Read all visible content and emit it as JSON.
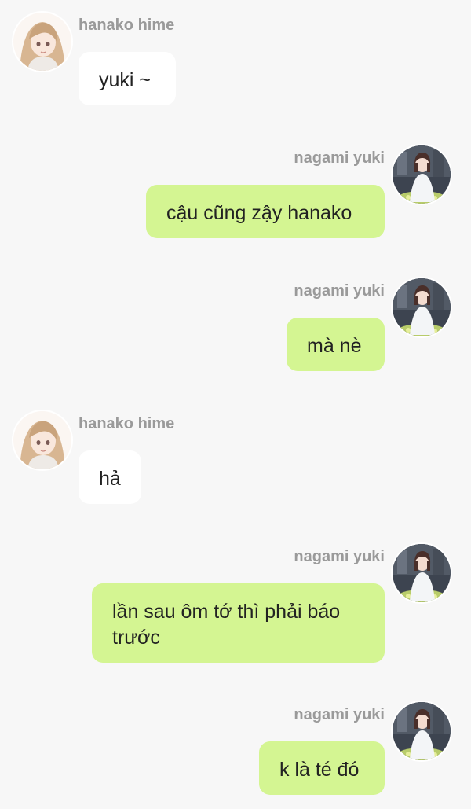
{
  "users": {
    "hanako": {
      "name": "hanako hime",
      "avatar_icon": "avatar-hanako-icon"
    },
    "yuki": {
      "name": "nagami yuki",
      "avatar_icon": "avatar-yuki-icon"
    }
  },
  "messages": [
    {
      "sender": "hanako hime",
      "side": "left",
      "text": "yuki ~"
    },
    {
      "sender": "nagami yuki",
      "side": "right",
      "text": "cậu cũng zậy hanako"
    },
    {
      "sender": "nagami yuki",
      "side": "right",
      "text": "mà nè"
    },
    {
      "sender": "hanako hime",
      "side": "left",
      "text": "hả"
    },
    {
      "sender": "nagami yuki",
      "side": "right",
      "text": "lần sau ôm tớ thì phải báo trước"
    },
    {
      "sender": "nagami yuki",
      "side": "right",
      "text": "k là té đó"
    }
  ],
  "colors": {
    "background": "#f7f7f7",
    "incoming_bubble": "#ffffff",
    "outgoing_bubble": "#d4f592",
    "name_text": "#9a9a9a"
  }
}
